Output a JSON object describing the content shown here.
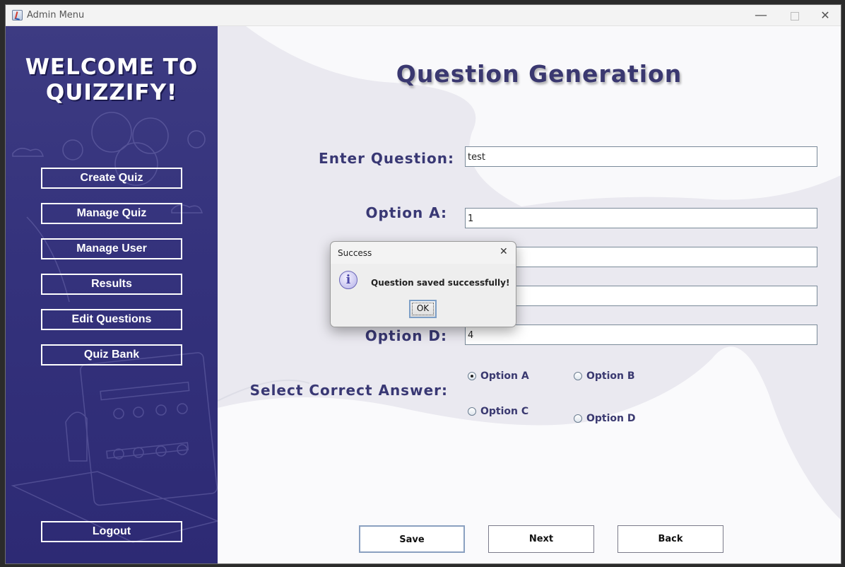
{
  "window": {
    "title": "Admin Menu",
    "minimize_glyph": "—",
    "close_glyph": "✕"
  },
  "sidebar": {
    "welcome_line1": "WELCOME TO",
    "welcome_line2": "QUIZZIFY!",
    "items": [
      {
        "label": "Create Quiz"
      },
      {
        "label": "Manage Quiz"
      },
      {
        "label": "Manage User"
      },
      {
        "label": "Results"
      },
      {
        "label": "Edit Questions"
      },
      {
        "label": "Quiz Bank"
      }
    ],
    "logout": "Logout"
  },
  "main": {
    "heading": "Question Generation",
    "question_label": "Enter Question:",
    "question_value": "test",
    "option_a_label": "Option A:",
    "option_a_value": "1",
    "option_b_value": "",
    "option_c_value": "",
    "option_d_label": "Option D:",
    "option_d_value": "4",
    "correct_label": "Select Correct Answer:",
    "radios": [
      {
        "label": "Option A",
        "checked": true
      },
      {
        "label": "Option B",
        "checked": false
      },
      {
        "label": "Option C",
        "checked": false
      },
      {
        "label": "Option D",
        "checked": false
      }
    ],
    "save": "Save",
    "next": "Next",
    "back": "Back"
  },
  "dialog": {
    "title": "Success",
    "close_glyph": "✕",
    "info_glyph": "i",
    "message": "Question saved successfully!",
    "ok": "OK"
  },
  "colors": {
    "sidebar": "#34327c",
    "heading": "#3a3870",
    "background": "#eeedf3"
  }
}
